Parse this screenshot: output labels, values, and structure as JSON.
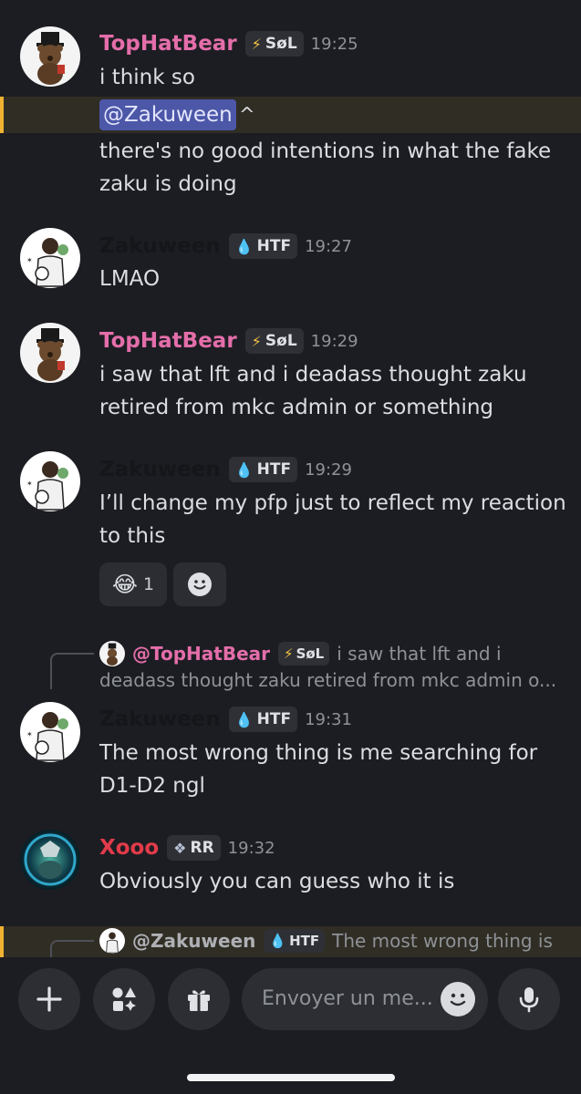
{
  "messages": [
    {
      "author": "TopHatBear",
      "tag": "SøL",
      "tag_icon": "lightning-icon",
      "time": "19:25",
      "lines": [
        "i think so"
      ]
    },
    {
      "mention": "@Zakuween",
      "mention_suffix": "^",
      "lines": [
        "there's no good intentions in what the fake",
        "zaku is doing"
      ]
    },
    {
      "author": "Zakuween",
      "tag": "HTF",
      "tag_icon": "droplet-icon",
      "time": "19:27",
      "lines": [
        "LMAO"
      ]
    },
    {
      "author": "TopHatBear",
      "tag": "SøL",
      "tag_icon": "lightning-icon",
      "time": "19:29",
      "lines": [
        "i saw that lft and i deadass thought zaku",
        "retired from mkc admin or something"
      ]
    },
    {
      "author": "Zakuween",
      "tag": "HTF",
      "tag_icon": "droplet-icon",
      "time": "19:29",
      "lines": [
        "I’ll change my pfp just to reflect my reaction",
        "to this"
      ],
      "reaction": {
        "emoji": "😂",
        "count": "1"
      }
    },
    {
      "reply": {
        "author": "@TopHatBear",
        "tag": "SøL",
        "text1": "i saw that lft and i",
        "text2": "deadass thought zaku retired from mkc admin o..."
      },
      "author": "Zakuween",
      "tag": "HTF",
      "tag_icon": "droplet-icon",
      "time": "19:31",
      "lines": [
        "The most wrong thing is me searching for",
        "D1-D2 ngl"
      ]
    },
    {
      "author": "Xooo",
      "tag": "RR",
      "tag_icon": "diamond-icon",
      "time": "19:32",
      "lines": [
        "Obviously you can guess who it is"
      ]
    },
    {
      "reply": {
        "author": "@Zakuween",
        "tag": "HTF",
        "text1": "The most wrong thing is"
      }
    }
  ],
  "composer": {
    "placeholder": "Envoyer un me..."
  },
  "colors": {
    "background": "#1c1d22",
    "pink_name": "#e46eaa",
    "red_name": "#e23b4a",
    "mention_bg": "#4c57a8",
    "mention_highlight": "#f0b232"
  }
}
